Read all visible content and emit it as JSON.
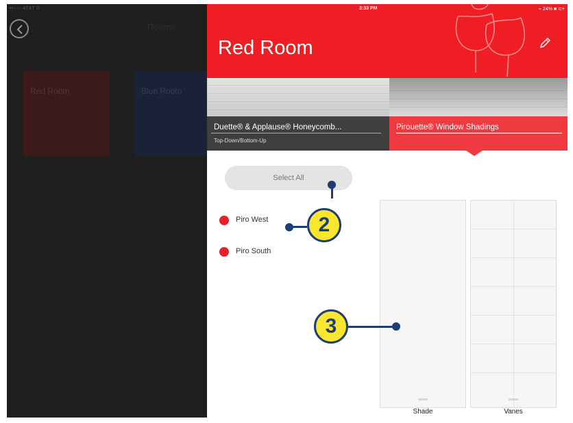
{
  "status": {
    "carrier": "••○○○ AT&T ☰",
    "time": "3:33 PM",
    "battery": "⌁ 24% ■ ⊂+"
  },
  "left": {
    "title": "Rooms",
    "tiles": [
      "Red Room",
      "Blue Room"
    ]
  },
  "header": {
    "room_title": "Red Room",
    "color": "#ef1d24"
  },
  "products": [
    {
      "name": "Duette® & Applause® Honeycomb...",
      "subtitle": "Top-Down/Bottom-Up"
    },
    {
      "name": "Pirouette® Window Shadings",
      "subtitle": ""
    }
  ],
  "controls": {
    "select_all": "Select All"
  },
  "shades": [
    {
      "label": "Piro West"
    },
    {
      "label": "Piro South"
    }
  ],
  "columns": {
    "shade": "Shade",
    "vanes": "Vanes"
  },
  "callouts": {
    "c2": "2",
    "c3": "3"
  }
}
